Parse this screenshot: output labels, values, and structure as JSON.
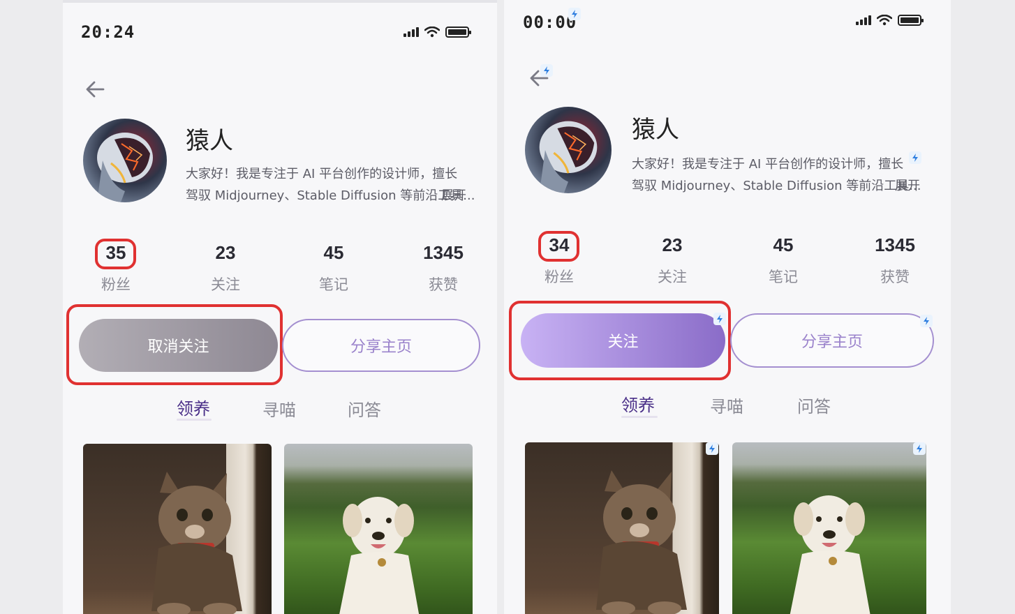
{
  "left": {
    "status_time": "20:24",
    "username": "猿人",
    "bio_line1": "大家好！我是专注于 AI 平台创作的设计师，擅长",
    "bio_line2": "驾驭 Midjourney、Stable Diffusion 等前沿工具...",
    "expand": "展开",
    "stats": [
      {
        "value": "35",
        "label": "粉丝"
      },
      {
        "value": "23",
        "label": "关注"
      },
      {
        "value": "45",
        "label": "笔记"
      },
      {
        "value": "1345",
        "label": "获赞"
      }
    ],
    "follow_button": "取消关注",
    "share_button": "分享主页",
    "tabs": [
      "领养",
      "寻喵",
      "问答"
    ]
  },
  "right": {
    "status_time": "00:00",
    "username": "猿人",
    "bio_line1": "大家好！我是专注于 AI 平台创作的设计师，擅长",
    "bio_line2": "驾驭 Midjourney、Stable Diffusion 等前沿工具...",
    "expand": "展开",
    "stats": [
      {
        "value": "34",
        "label": "粉丝"
      },
      {
        "value": "23",
        "label": "关注"
      },
      {
        "value": "45",
        "label": "笔记"
      },
      {
        "value": "1345",
        "label": "获赞"
      }
    ],
    "follow_button": "关注",
    "share_button": "分享主页",
    "tabs": [
      "领养",
      "寻喵",
      "问答"
    ]
  },
  "colors": {
    "highlight_red": "#e03131",
    "unfollow_gray": "#9e9aa3",
    "follow_purple": "#8f6cd0",
    "tab_active": "#4a2f88"
  },
  "icons": [
    "back-arrow-icon",
    "signal-icon",
    "wifi-icon",
    "battery-icon",
    "ai-edit-badge-icon"
  ]
}
